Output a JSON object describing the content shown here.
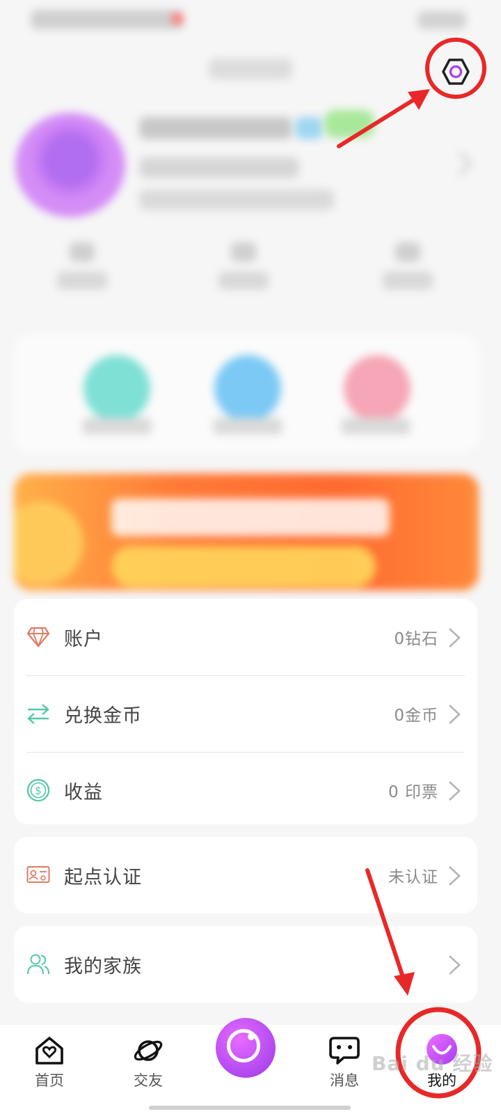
{
  "menu": {
    "account": {
      "label": "账户",
      "value": "0钻石",
      "icon": "diamond-icon"
    },
    "exchange": {
      "label": "兑换金币",
      "value": "0金币",
      "icon": "swap-arrows-icon"
    },
    "earnings": {
      "label": "收益",
      "value": "0 印票",
      "icon": "dollar-coin-icon"
    },
    "certification": {
      "label": "起点认证",
      "value": "未认证",
      "icon": "id-card-icon"
    },
    "family": {
      "label": "我的家族",
      "value": "",
      "icon": "people-icon"
    }
  },
  "bottom_nav": {
    "home": "首页",
    "friends": "交友",
    "messages": "消息",
    "me": "我的"
  },
  "colors": {
    "accent_purple": "#b84df2",
    "diamond": "#e07a63",
    "teal": "#4fc9a8",
    "annotation_red": "#e82828"
  },
  "watermark": "Bai du 经验"
}
